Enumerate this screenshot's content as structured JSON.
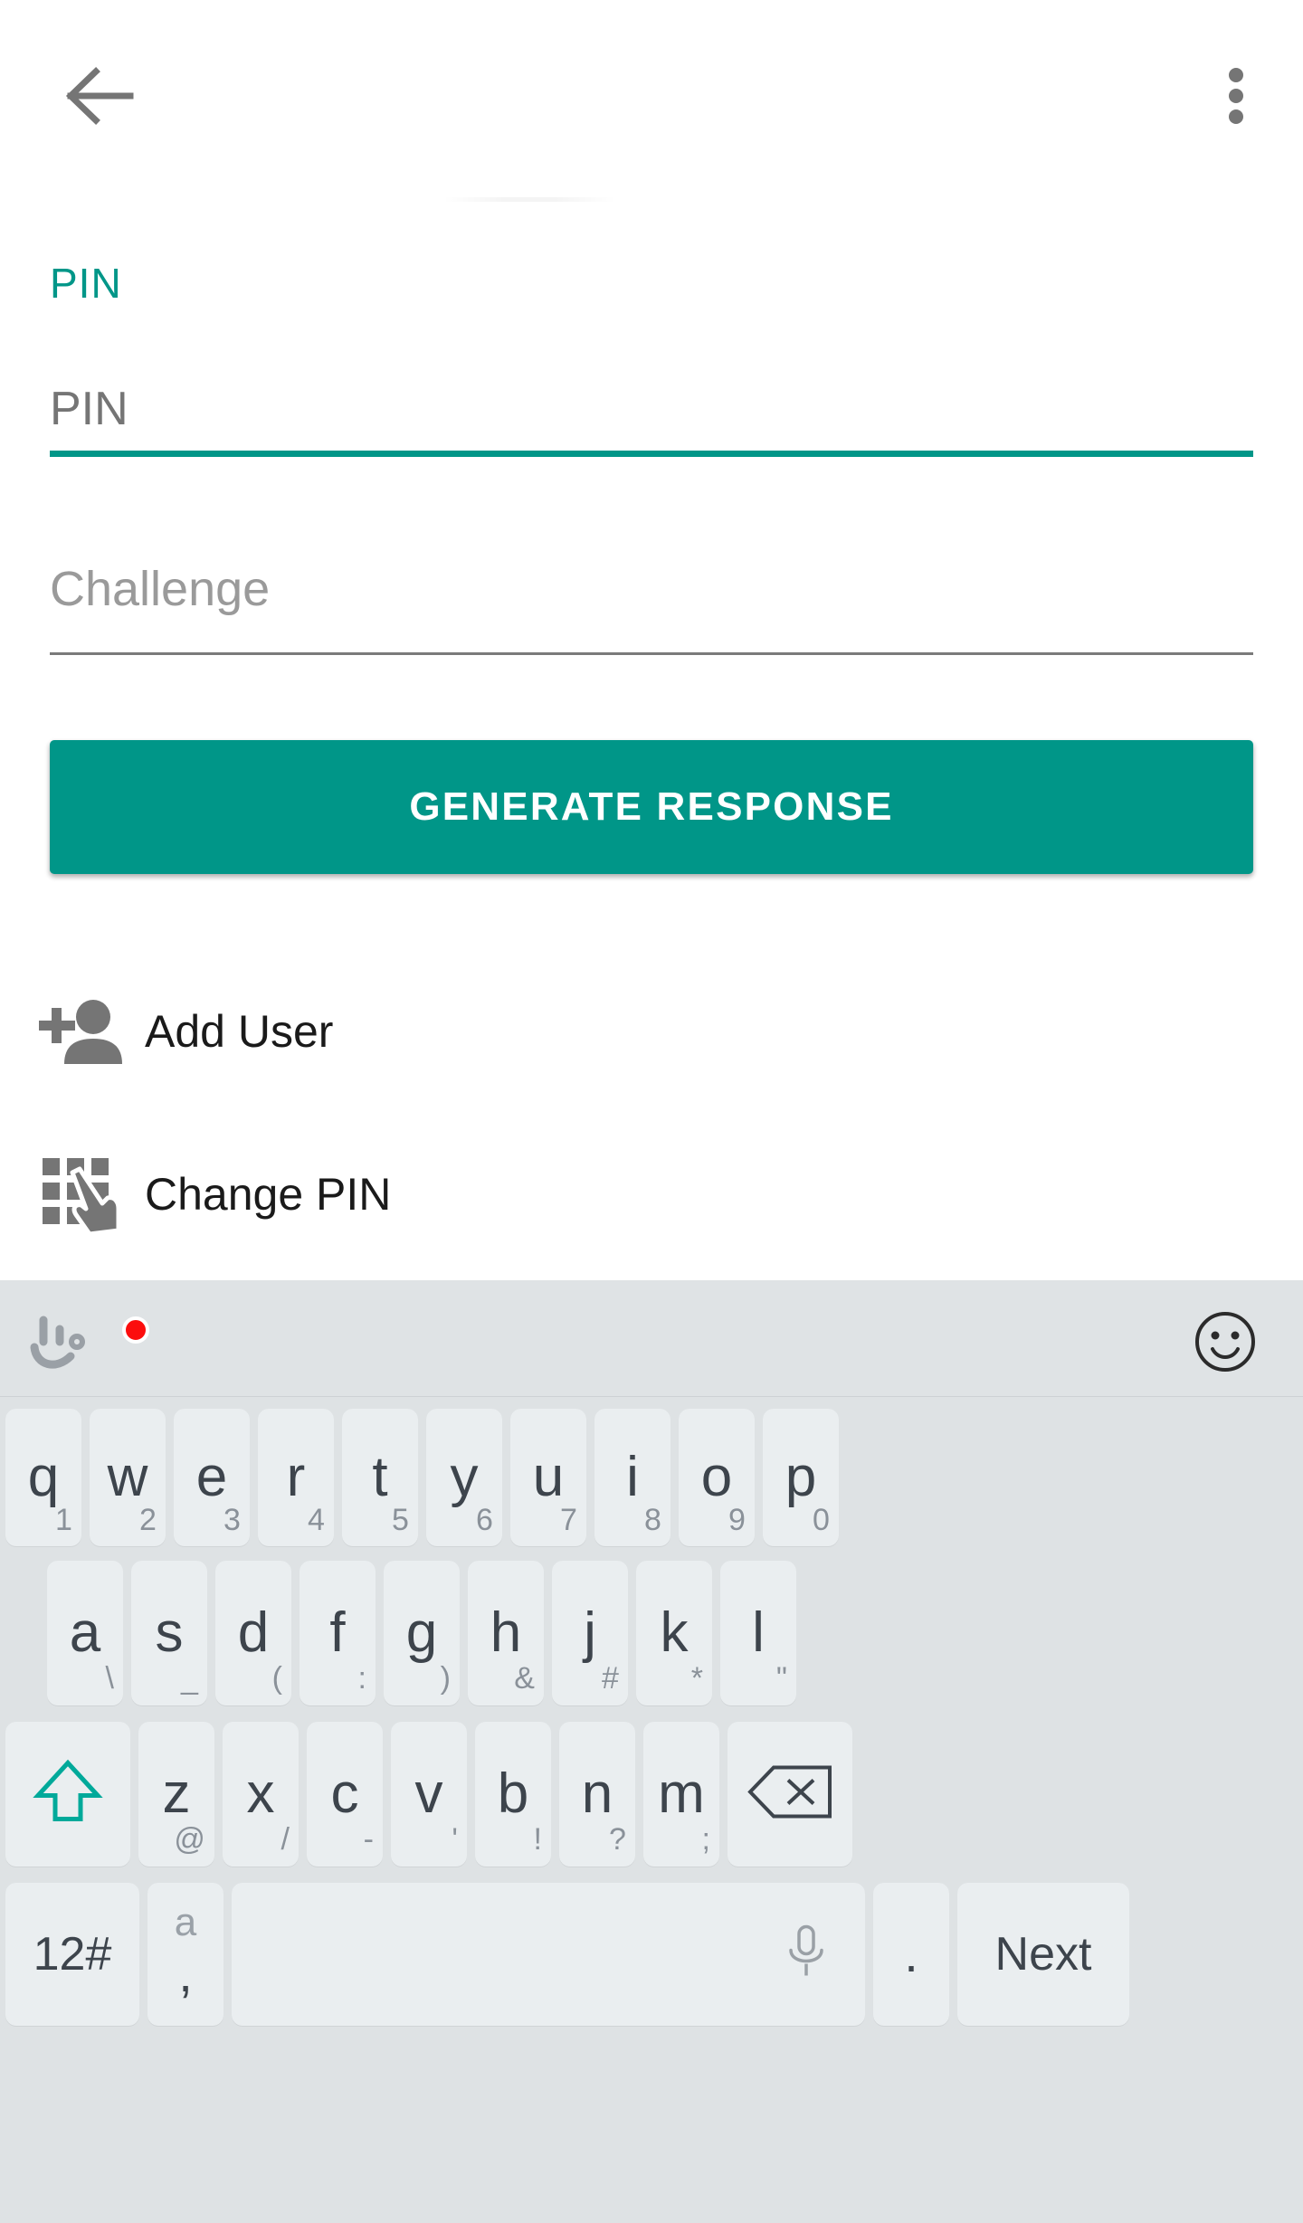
{
  "colors": {
    "accent": "#009688",
    "key_bg": "#eaeef0",
    "keyboard_bg": "#dee2e4",
    "icon_gray": "#757575",
    "red_dot": "#fc0d0d",
    "key_text": "#3d444c",
    "key_sub_text": "#8a9199"
  },
  "appbar": {
    "back_icon": "arrow-back-icon",
    "overflow_icon": "overflow-menu-icon"
  },
  "form": {
    "pin": {
      "label": "PIN",
      "value": "",
      "placeholder": "PIN"
    },
    "challenge": {
      "value": "",
      "placeholder": "Challenge"
    },
    "generate_button": "GENERATE RESPONSE"
  },
  "menu": [
    {
      "label": "Add User",
      "icon": "person-add-icon"
    },
    {
      "label": "Change PIN",
      "icon": "dialpad-touch-icon"
    }
  ],
  "keyboard": {
    "toolbar": {
      "logo_icon": "touchpal-logo-icon",
      "badge": "",
      "emoji_icon": "emoji-smiley-icon"
    },
    "rows": [
      [
        {
          "main": "q",
          "sub": "1"
        },
        {
          "main": "w",
          "sub": "2"
        },
        {
          "main": "e",
          "sub": "3"
        },
        {
          "main": "r",
          "sub": "4"
        },
        {
          "main": "t",
          "sub": "5"
        },
        {
          "main": "y",
          "sub": "6"
        },
        {
          "main": "u",
          "sub": "7"
        },
        {
          "main": "i",
          "sub": "8"
        },
        {
          "main": "o",
          "sub": "9"
        },
        {
          "main": "p",
          "sub": "0"
        }
      ],
      [
        {
          "main": "a",
          "sub": "\\"
        },
        {
          "main": "s",
          "sub": "_"
        },
        {
          "main": "d",
          "sub": "("
        },
        {
          "main": "f",
          "sub": ":"
        },
        {
          "main": "g",
          "sub": ")"
        },
        {
          "main": "h",
          "sub": "&"
        },
        {
          "main": "j",
          "sub": "#"
        },
        {
          "main": "k",
          "sub": "*"
        },
        {
          "main": "l",
          "sub": "\""
        }
      ],
      [
        {
          "main": "",
          "sub": "",
          "icon": "shift-icon"
        },
        {
          "main": "z",
          "sub": "@"
        },
        {
          "main": "x",
          "sub": "/"
        },
        {
          "main": "c",
          "sub": "-"
        },
        {
          "main": "v",
          "sub": "'"
        },
        {
          "main": "b",
          "sub": "!"
        },
        {
          "main": "n",
          "sub": "?"
        },
        {
          "main": "m",
          "sub": ";"
        },
        {
          "main": "",
          "sub": "",
          "icon": "backspace-icon"
        }
      ],
      [
        {
          "main": "12#",
          "sub": ""
        },
        {
          "main": ",",
          "sub": "",
          "top": "a"
        },
        {
          "main": "",
          "sub": "",
          "icon": "microphone-icon"
        },
        {
          "main": ".",
          "sub": ""
        },
        {
          "main": "Next",
          "sub": ""
        }
      ]
    ]
  }
}
